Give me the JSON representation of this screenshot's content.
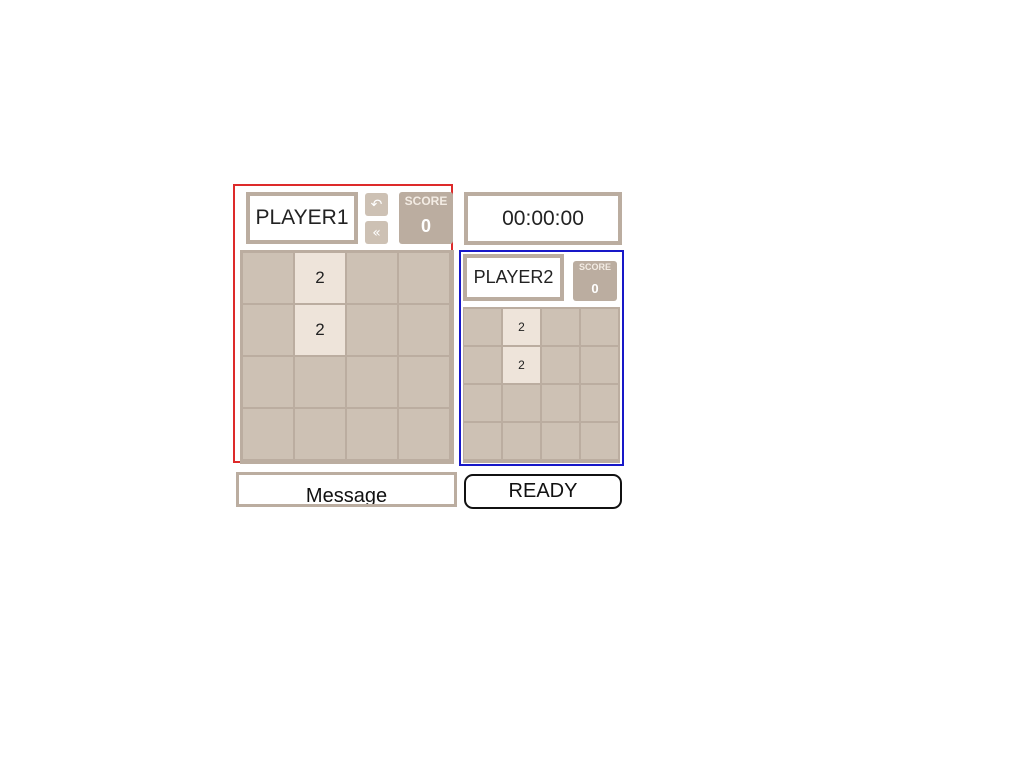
{
  "player1": {
    "name": "PLAYER1",
    "undo_icon": "undo-icon",
    "rewind_icon": "double-chevron-left-icon",
    "undo_glyph": "↶",
    "rewind_glyph": "«",
    "score_label": "SCORE",
    "score_value": "0",
    "frame_color": "#dd2a2a",
    "board": [
      [
        "",
        "2",
        "",
        ""
      ],
      [
        "",
        "2",
        "",
        ""
      ],
      [
        "",
        "",
        "",
        ""
      ],
      [
        "",
        "",
        "",
        ""
      ]
    ]
  },
  "timer": {
    "value": "00:00:00"
  },
  "player2": {
    "name": "PLAYER2",
    "score_label": "SCORE",
    "score_value": "0",
    "frame_color": "#1818c8",
    "board": [
      [
        "",
        "2",
        "",
        ""
      ],
      [
        "",
        "2",
        "",
        ""
      ],
      [
        "",
        "",
        "",
        ""
      ],
      [
        "",
        "",
        "",
        ""
      ]
    ]
  },
  "message": {
    "text": "Message"
  },
  "ready_button": {
    "label": "READY"
  }
}
